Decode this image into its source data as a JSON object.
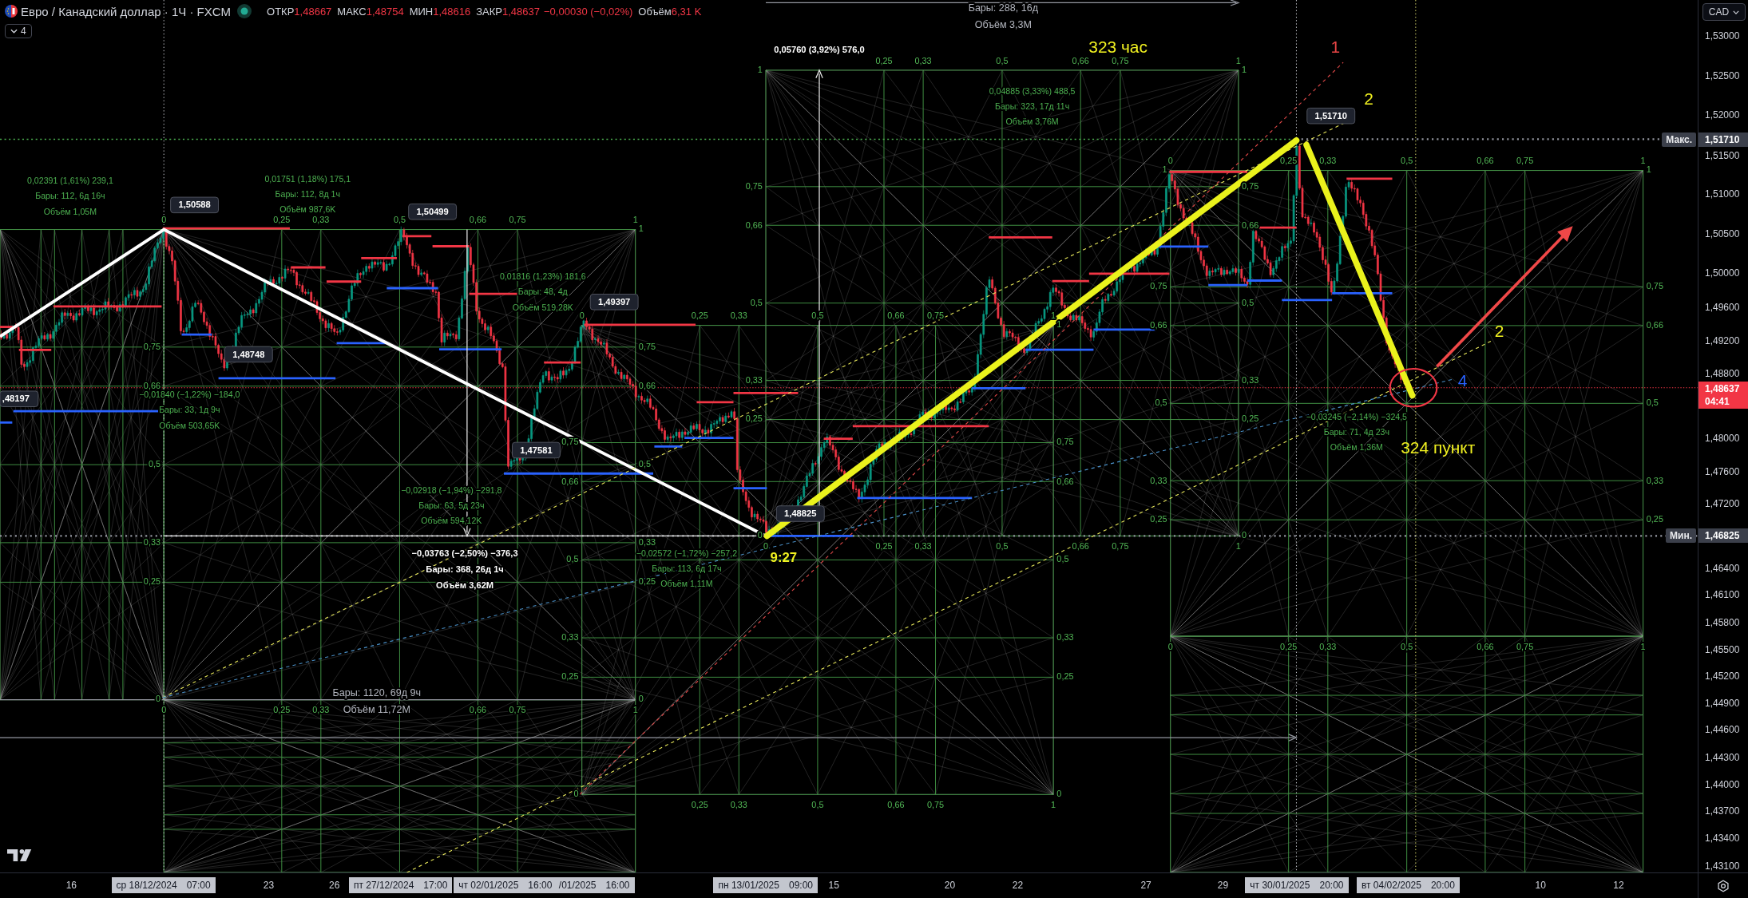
{
  "legend": {
    "title": "Евро / Канадский доллар · 1Ч · FXCM",
    "down": true,
    "values": [
      {
        "label": "ОТКР",
        "value": "1,48667"
      },
      {
        "label": "МАКС",
        "value": "1,48754"
      },
      {
        "label": "МИН",
        "value": "1,48616"
      },
      {
        "label": "ЗАКР",
        "value": "1,48637"
      }
    ],
    "change": "−0,00030 (−0,02%)",
    "volume_label": "Объём",
    "volume": "6,31 K",
    "indicator_count": "4"
  },
  "chart": {
    "gann_boxes": [
      {
        "top_labels": [
          "0",
          "0,25",
          "0,33",
          "0,5",
          "0,66",
          "0,75",
          "1"
        ],
        "left_labels": [
          "0,75",
          "0,66",
          "0,5",
          "0,33",
          "0,25",
          "0"
        ],
        "right_labels": [
          "1",
          "0,75",
          "0,66",
          "0,5",
          "0,33",
          "0,25",
          "0"
        ],
        "bottom_labels": [
          "0",
          "0,25",
          "0,33",
          "0,66",
          "0,75",
          "1"
        ]
      },
      {
        "top_labels": [
          "0,25",
          "0,33",
          "0,5",
          "0,66",
          "0,75",
          "1"
        ],
        "left_labels": [
          "1",
          "0,75",
          "0,66",
          "0,5",
          "0,33",
          "0,25",
          "0"
        ],
        "right_labels": [
          "1",
          "0,75",
          "0,66",
          "0,5",
          "0,33",
          "0,25",
          "0"
        ],
        "bottom_labels": [
          "0",
          "0,25",
          "0,33",
          "0,5",
          "0,66",
          "0,75",
          "1"
        ]
      },
      {
        "top_labels": [
          "0",
          "0,25",
          "0,33",
          "0,5",
          "0,66",
          "0,75",
          "1"
        ],
        "left_labels": [
          "1",
          "0,75",
          "0,66",
          "0,5",
          "0,33",
          "0,25"
        ],
        "right_labels": [
          "1",
          "0,75",
          "0,66",
          "0,5",
          "0,33",
          "0,25"
        ],
        "bottom_labels": [
          "0",
          "0,25",
          "0,33",
          "0,5",
          "0,66",
          "0,75",
          "1"
        ]
      },
      {
        "top_labels": [
          "0",
          "0,25",
          "0,33",
          "0,5",
          "0,66",
          "0,75",
          "1"
        ],
        "left_labels": [
          "0,75",
          "0,66",
          "0,5",
          "0,33",
          "0,25",
          "0"
        ],
        "right_labels": [
          "1",
          "0,75",
          "0,66",
          "0,5",
          "0,33",
          "0,25",
          "0"
        ],
        "bottom_labels": [
          "0,25",
          "0,33",
          "0,5",
          "0,66",
          "0,75",
          "1"
        ]
      }
    ],
    "price_tags": [
      "1,50588",
      "1,50499",
      "1,48748",
      "1,49397",
      "1,47581",
      ",48197",
      "1,48825",
      "1,51710"
    ],
    "measurements": [
      {
        "kind": "span",
        "lines": [
          "Бары: 288, 16д",
          "Объём 3,3M"
        ]
      },
      {
        "kind": "total",
        "lines": [
          "0,05760 (3,92%) 576,0"
        ]
      },
      {
        "kind": "range",
        "lines": [
          "0,04885 (3,33%) 488,5",
          "Бары: 323, 17д 11ч",
          "Объём 3,76M"
        ]
      },
      {
        "kind": "range",
        "lines": [
          "0,02391 (1,61%) 239,1",
          "Бары: 112, 6д 16ч",
          "Объём 1,05M"
        ]
      },
      {
        "kind": "range",
        "lines": [
          "0,01751 (1,18%) 175,1",
          "Бары: 112, 8д 1ч",
          "Объём 987,6K"
        ]
      },
      {
        "kind": "range",
        "lines": [
          "0,01816 (1,23%) 181,6",
          "Бары: 48, 4д",
          "Объём 519,28K"
        ]
      },
      {
        "kind": "range",
        "lines": [
          "−0,01840 (−1,22%) −184,0",
          "Бары: 33, 1д 9ч",
          "Объём 503,65K"
        ]
      },
      {
        "kind": "range",
        "lines": [
          "−0,03245 (−2,14%) −324,5",
          "Бары: 71, 4д 23ч",
          "Объём 1,36M"
        ]
      },
      {
        "kind": "range",
        "lines": [
          "−0,02918 (−1,94%) −291,8",
          "Бары: 63, 5д 23ч",
          "Объём 594,12K"
        ]
      },
      {
        "kind": "total",
        "lines": [
          "−0,03763 (−2,50%) −376,3",
          "Бары: 368, 26д 1ч",
          "Объём 3,62M"
        ]
      },
      {
        "kind": "range",
        "lines": [
          "−0,02572 (−1,72%) −257,2",
          "Бары: 113, 6д 17ч",
          "Объём 1,11M"
        ]
      },
      {
        "kind": "span",
        "lines": [
          "Бары: 1120, 69д 9ч",
          "Объём 11,72M"
        ]
      }
    ],
    "annotations": [
      {
        "text": "323 час",
        "color": "#f0f020"
      },
      {
        "text": "1",
        "color": "#e84545"
      },
      {
        "text": "2",
        "color": "#f0f020"
      },
      {
        "text": "2",
        "color": "#f0f020"
      },
      {
        "text": "4",
        "color": "#2962ff"
      },
      {
        "text": "324 пункт",
        "color": "#f0f020"
      },
      {
        "text": "9:27",
        "color": "#f0f020"
      }
    ]
  },
  "price_axis": {
    "currency": "CAD",
    "ticks": [
      "1,53000",
      "1,52500",
      "1,52000",
      "1,51500",
      "1,51000",
      "1,50500",
      "1,50000",
      "1,49600",
      "1,49200",
      "1,48800",
      "1,48000",
      "1,47600",
      "1,47200",
      "1,46400",
      "1,46100",
      "1,45800",
      "1,45500",
      "1,45200",
      "1,44900",
      "1,44600",
      "1,44300",
      "1,44000",
      "1,43700",
      "1,43400",
      "1,43100"
    ],
    "max_marker": {
      "label": "Макс.",
      "price": "1,51710"
    },
    "last_price": {
      "price": "1,48637",
      "countdown": "04:41"
    },
    "min_marker": {
      "label": "Мин.",
      "price": "1,46825"
    }
  },
  "time_axis": {
    "labels": [
      {
        "kind": "tick",
        "text": "16"
      },
      {
        "kind": "marker",
        "date": "ср 18/12/2024",
        "time": "07:00"
      },
      {
        "kind": "tick",
        "text": "23"
      },
      {
        "kind": "tick",
        "text": "26"
      },
      {
        "kind": "marker",
        "date": "пт 27/12/2024",
        "time": "17:00"
      },
      {
        "kind": "marker",
        "date": "чт 02/01/2025",
        "time": "16:00"
      },
      {
        "kind": "marker",
        "date": "/01/2025",
        "time": "16:00"
      },
      {
        "kind": "marker",
        "date": "пн 13/01/2025",
        "time": "09:00"
      },
      {
        "kind": "tick",
        "text": "15"
      },
      {
        "kind": "tick",
        "text": "20"
      },
      {
        "kind": "tick",
        "text": "22"
      },
      {
        "kind": "tick",
        "text": "27"
      },
      {
        "kind": "tick",
        "text": "29"
      },
      {
        "kind": "marker",
        "date": "чт 30/01/2025",
        "time": "20:00"
      },
      {
        "kind": "marker",
        "date": "вт 04/02/2025",
        "time": "20:00"
      },
      {
        "kind": "tick",
        "text": "10"
      },
      {
        "kind": "tick",
        "text": "12"
      }
    ]
  }
}
